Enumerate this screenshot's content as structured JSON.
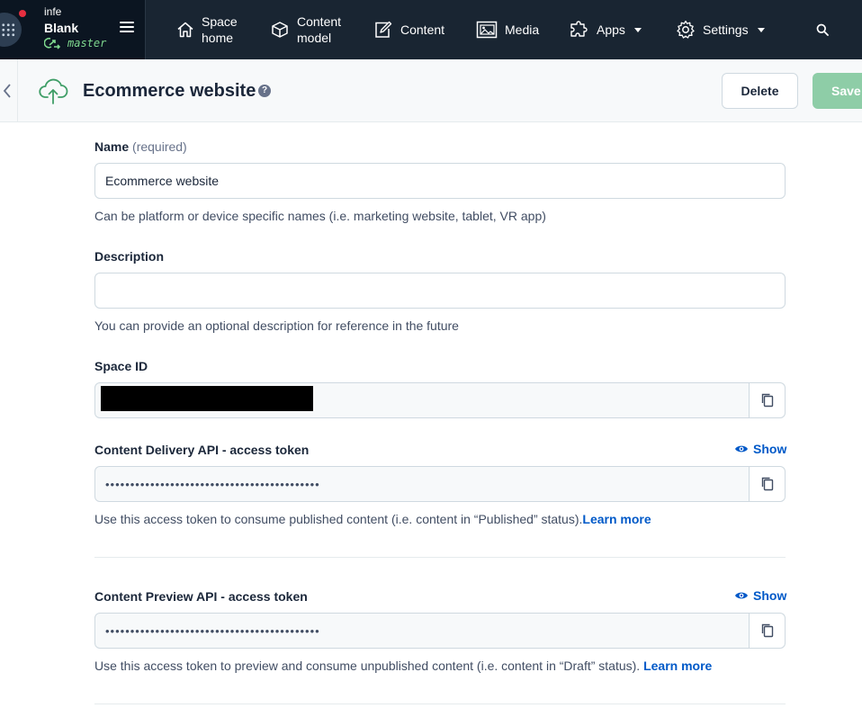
{
  "nav": {
    "org_name": "infe",
    "space_name": "Blank",
    "environment": "master",
    "items": [
      {
        "line1": "Space",
        "line2": "home"
      },
      {
        "line1": "Content",
        "line2": "model"
      },
      {
        "label": "Content"
      },
      {
        "label": "Media"
      },
      {
        "label": "Apps"
      },
      {
        "label": "Settings"
      }
    ]
  },
  "header": {
    "title": "Ecommerce website",
    "delete_label": "Delete",
    "save_label": "Save"
  },
  "form": {
    "name": {
      "label": "Name",
      "required_text": "(required)",
      "value": "Ecommerce website",
      "help": "Can be platform or device specific names (i.e. marketing website, tablet, VR app)"
    },
    "description": {
      "label": "Description",
      "value": "",
      "help": "You can provide an optional description for reference in the future"
    },
    "space_id": {
      "label": "Space ID"
    },
    "cda_token": {
      "label": "Content Delivery API - access token",
      "show_label": "Show",
      "masked_value": "•••••••••••••••••••••••••••••••••••••••••••",
      "help": "Use this access token to consume published content (i.e. content in “Published” status).",
      "learn_more": "Learn more"
    },
    "cpa_token": {
      "label": "Content Preview API - access token",
      "show_label": "Show",
      "masked_value": "•••••••••••••••••••••••••••••••••••••••••••",
      "help": "Use this access token to preview and consume unpublished content (i.e. content in “Draft” status). ",
      "learn_more": "Learn more"
    }
  },
  "colors": {
    "nav_bg": "#192532",
    "accent_link": "#0059c8",
    "save_disabled": "#8ecda7",
    "environment_green": "#7fd98f"
  },
  "icons": [
    "app-grid-icon",
    "hamburger-icon",
    "environment-branch-icon",
    "home-icon",
    "content-model-icon",
    "content-icon",
    "media-icon",
    "apps-icon",
    "settings-gear-icon",
    "search-icon",
    "chevron-left-icon",
    "cloud-upload-icon",
    "help-icon",
    "eye-icon",
    "copy-icon"
  ]
}
